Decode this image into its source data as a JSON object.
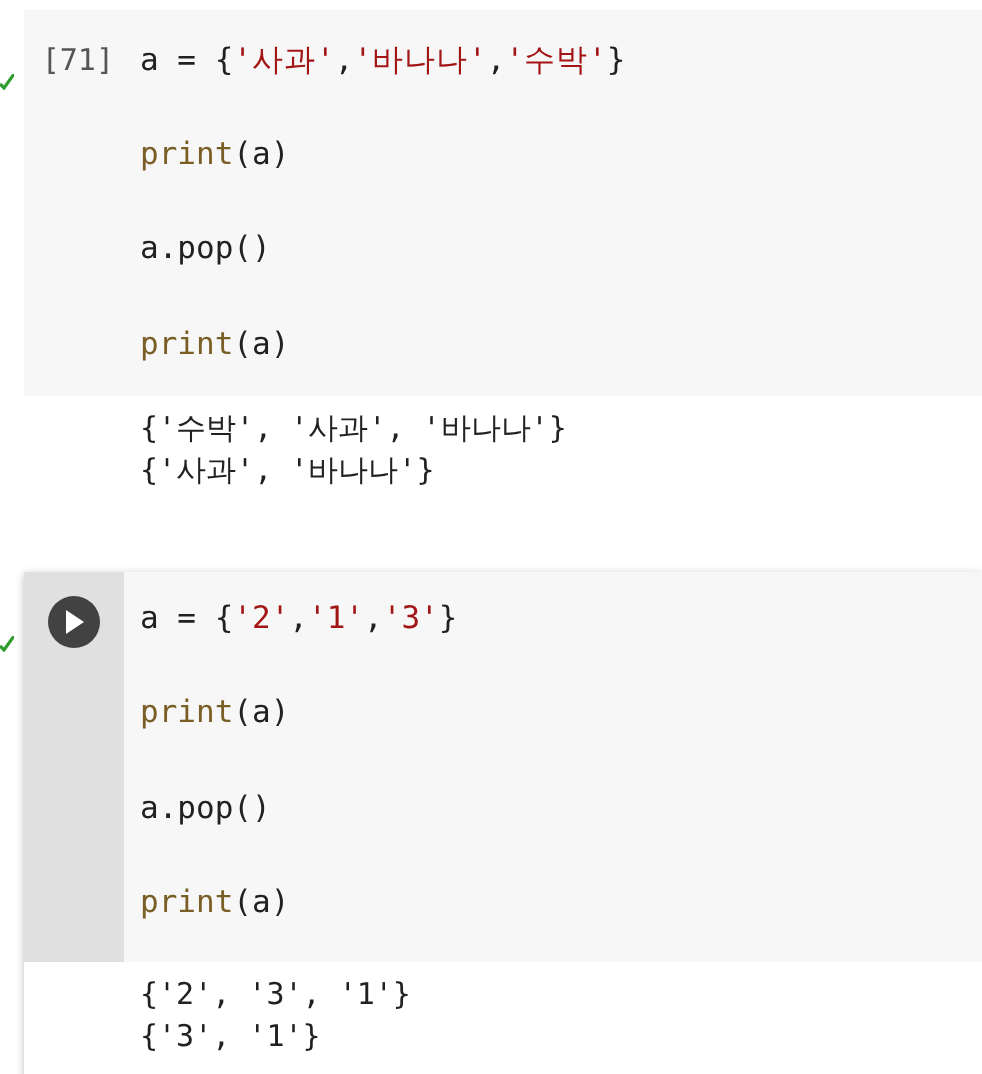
{
  "cells": [
    {
      "gutter": {
        "kind": "count",
        "text": "[71]"
      },
      "done": true,
      "focused": false,
      "code": [
        [
          {
            "kind": "plain",
            "text": "a = {"
          },
          {
            "kind": "string",
            "text": "'사과'"
          },
          {
            "kind": "plain",
            "text": ","
          },
          {
            "kind": "string",
            "text": "'바나나'"
          },
          {
            "kind": "plain",
            "text": ","
          },
          {
            "kind": "string",
            "text": "'수박'"
          },
          {
            "kind": "plain",
            "text": "}"
          }
        ],
        [
          {
            "kind": "builtin",
            "text": "print"
          },
          {
            "kind": "plain",
            "text": "(a)"
          }
        ],
        [
          {
            "kind": "plain",
            "text": "a.pop()"
          }
        ],
        [
          {
            "kind": "builtin",
            "text": "print"
          },
          {
            "kind": "plain",
            "text": "(a)"
          }
        ]
      ],
      "output": [
        "{'수박', '사과', '바나나'}",
        "{'사과', '바나나'}"
      ]
    },
    {
      "gutter": {
        "kind": "run-button"
      },
      "done": true,
      "focused": true,
      "code": [
        [
          {
            "kind": "plain",
            "text": "a = {"
          },
          {
            "kind": "string",
            "text": "'2'"
          },
          {
            "kind": "plain",
            "text": ","
          },
          {
            "kind": "string",
            "text": "'1'"
          },
          {
            "kind": "plain",
            "text": ","
          },
          {
            "kind": "string",
            "text": "'3'"
          },
          {
            "kind": "plain",
            "text": "}"
          }
        ],
        [
          {
            "kind": "builtin",
            "text": "print"
          },
          {
            "kind": "plain",
            "text": "(a)"
          }
        ],
        [
          {
            "kind": "plain",
            "text": "a.pop()"
          }
        ],
        [
          {
            "kind": "builtin",
            "text": "print"
          },
          {
            "kind": "plain",
            "text": "(a)"
          }
        ]
      ],
      "output": [
        "{'2', '3', '1'}",
        "{'3', '1'}"
      ]
    }
  ]
}
